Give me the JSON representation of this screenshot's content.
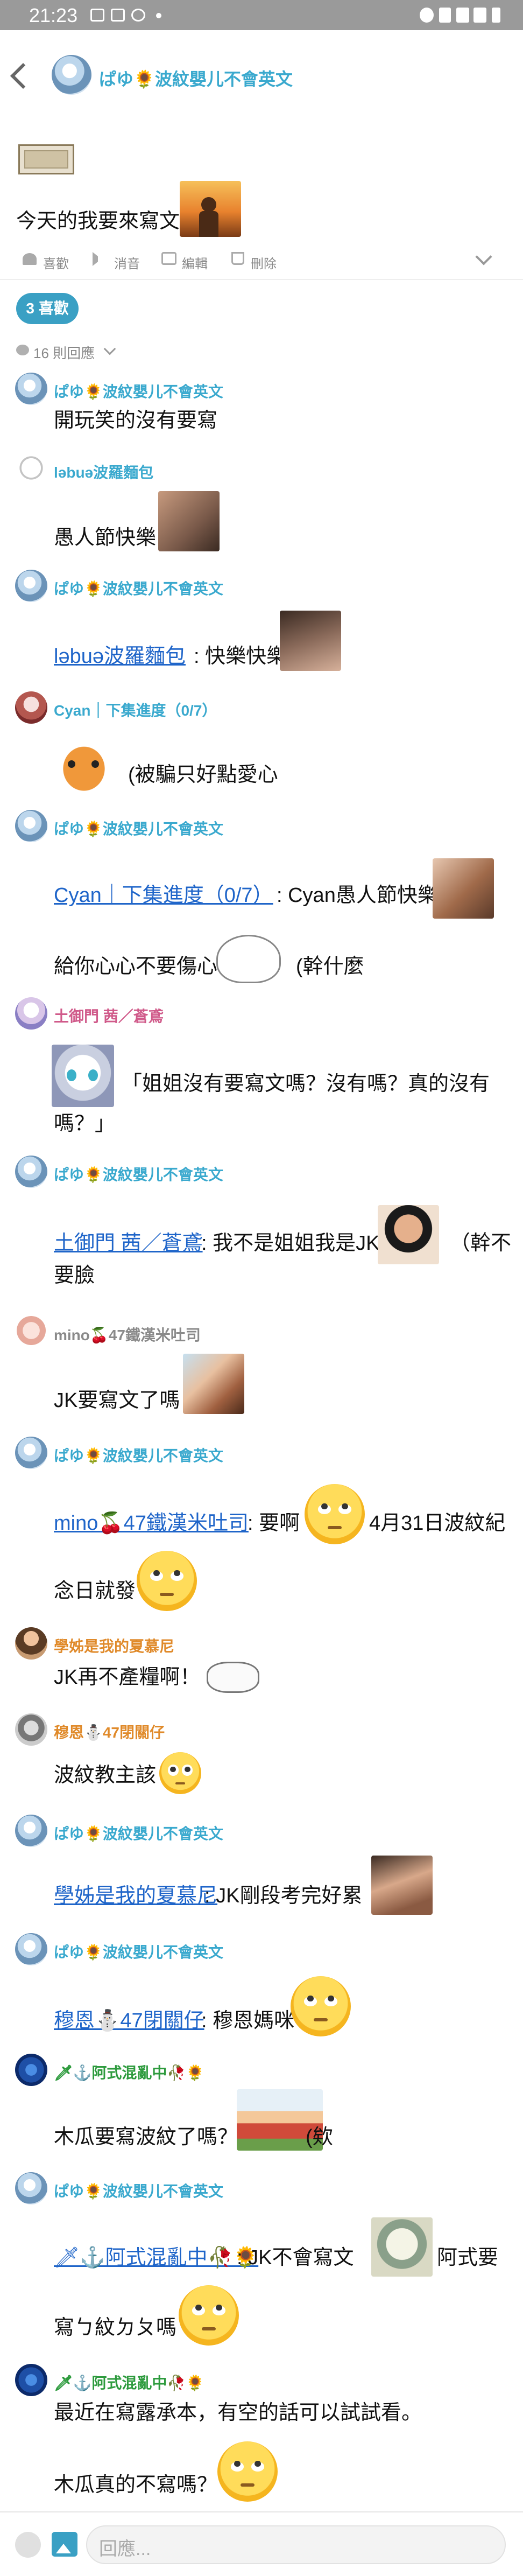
{
  "status": {
    "time": "21:23"
  },
  "header": {
    "author": "ぱゆ🌻波紋嬰儿不會英文"
  },
  "post": {
    "body": "今天的我要來寫文"
  },
  "actions": {
    "like": "喜歡",
    "comment": "消音",
    "edit": "編輯",
    "delete": "刪除"
  },
  "likes_badge": "3 喜歡",
  "reply_count": "16 則回應",
  "replies": [
    {
      "author": "ぱゆ🌻波紋嬰儿不會英文",
      "text": "開玩笑的沒有要寫"
    },
    {
      "author": "ləbuə波羅麵包",
      "text": "愚人節快樂"
    },
    {
      "author": "ぱゆ🌻波紋嬰儿不會英文",
      "mention": "ləbuə波羅麵包",
      "text": ": 快樂快樂"
    },
    {
      "author": "Cyan｜下集進度（0/7）",
      "text": "(被騙只好點愛心"
    },
    {
      "author": "ぱゆ🌻波紋嬰儿不會英文",
      "mention": "Cyan｜下集進度（0/7）",
      "text": ": Cyan愚人節快樂",
      "text2": "給你心心不要傷心",
      "text3": "(幹什麼"
    },
    {
      "author": "土御門 茜／蒼鳶",
      "text": "「姐姐沒有要寫文嗎？沒有嗎？真的沒有",
      "text2": "嗎？」"
    },
    {
      "author": "ぱゆ🌻波紋嬰儿不會英文",
      "mention": "土御門 茜／蒼鳶",
      "text": ": 我不是姐姐我是JK",
      "text2": "（幹不",
      "text3": "要臉"
    },
    {
      "author": "mino🍒47鐵漢米吐司",
      "text": "JK要寫文了嗎"
    },
    {
      "author": "ぱゆ🌻波紋嬰儿不會英文",
      "mention": "mino🍒47鐵漢米吐司",
      "text": ": 要啊",
      "text2": "4月31日波紋紀",
      "text3": "念日就發"
    },
    {
      "author": "學姊是我的夏慕尼",
      "text": "JK再不產糧啊！"
    },
    {
      "author": "穆恩⛄47閉關仔",
      "text": "波紋教主該"
    },
    {
      "author": "ぱゆ🌻波紋嬰儿不會英文",
      "mention": "學姊是我的夏慕尼",
      "text": ": JK剛段考完好累"
    },
    {
      "author": "ぱゆ🌻波紋嬰儿不會英文",
      "mention": "穆恩⛄47閉關仔",
      "text": ": 穆恩媽咪"
    },
    {
      "author": "🗡⚓阿式混亂中🥀🌻",
      "text": "木瓜要寫波紋了嗎？",
      "text2": "(欸"
    },
    {
      "author": "ぱゆ🌻波紋嬰儿不會英文",
      "mention": "🗡⚓阿式混亂中🥀🌻",
      "text": ": JK不會寫文",
      "text2": "阿式要",
      "text3": "寫ㄅ紋ㄉㄆ嗎"
    },
    {
      "author": "🗡⚓阿式混亂中🥀🌻",
      "text": "最近在寫露承本，有空的話可以試試看。",
      "text2": "木瓜真的不寫嗎？"
    }
  ],
  "reply_input": {
    "placeholder": "回應..."
  },
  "colors": {
    "accent": "#3aa0c4",
    "link": "#1f65c9",
    "status_bar": "#9a9a9a"
  }
}
